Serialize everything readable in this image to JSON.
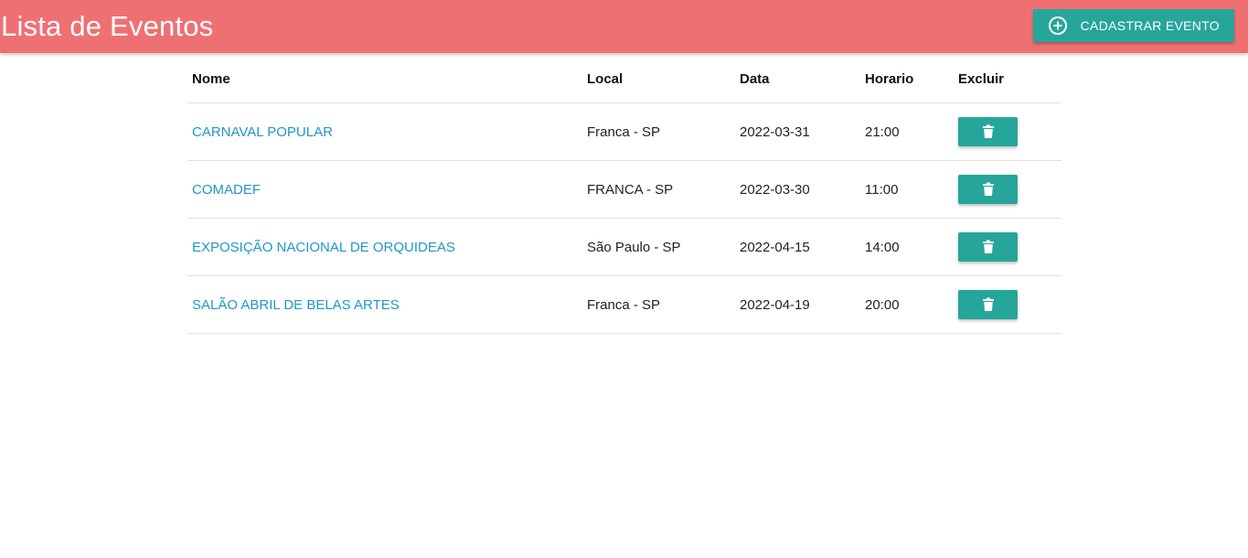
{
  "header": {
    "title": "Lista de Eventos",
    "add_button_label": "CADASTRAR EVENTO",
    "add_icon": "add-circle-icon",
    "background_color": "#ef7072",
    "accent_color": "#26a69a"
  },
  "table": {
    "columns": [
      "Nome",
      "Local",
      "Data",
      "Horario",
      "Excluir"
    ],
    "delete_icon": "trash-icon",
    "link_color": "#2196c8",
    "rows": [
      {
        "nome": "CARNAVAL POPULAR",
        "local": "Franca - SP",
        "data": "2022-03-31",
        "horario": "21:00"
      },
      {
        "nome": "COMADEF",
        "local": "FRANCA - SP",
        "data": "2022-03-30",
        "horario": "11:00"
      },
      {
        "nome": "EXPOSIÇÃO NACIONAL DE ORQUIDEAS",
        "local": "São Paulo - SP",
        "data": "2022-04-15",
        "horario": "14:00"
      },
      {
        "nome": "SALÃO ABRIL DE BELAS ARTES",
        "local": "Franca - SP",
        "data": "2022-04-19",
        "horario": "20:00"
      }
    ]
  }
}
